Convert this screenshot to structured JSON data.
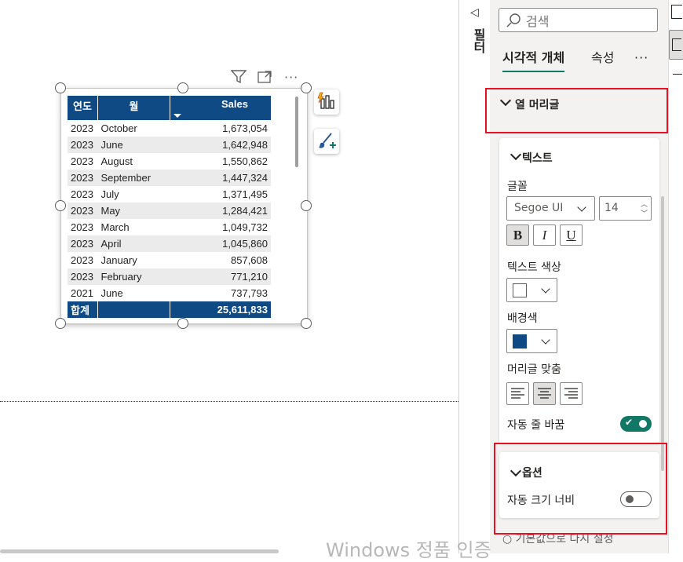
{
  "visual_header": {
    "filter_icon": "funnel-icon",
    "focus_icon": "focus-mode-icon",
    "more_label": "···"
  },
  "table": {
    "headers": [
      "연도",
      "월",
      "Sales"
    ],
    "rows": [
      [
        "2023",
        "October",
        "1,673,054"
      ],
      [
        "2023",
        "June",
        "1,642,948"
      ],
      [
        "2023",
        "August",
        "1,550,862"
      ],
      [
        "2023",
        "September",
        "1,447,324"
      ],
      [
        "2023",
        "July",
        "1,371,495"
      ],
      [
        "2023",
        "May",
        "1,284,421"
      ],
      [
        "2023",
        "March",
        "1,049,732"
      ],
      [
        "2023",
        "April",
        "1,045,860"
      ],
      [
        "2023",
        "January",
        "857,608"
      ],
      [
        "2023",
        "February",
        "771,210"
      ],
      [
        "2021",
        "June",
        "737,793"
      ]
    ],
    "total_label": "합계",
    "total_value": "25,611,833",
    "header_bg": "#0f4a85"
  },
  "float_buttons": {
    "build_icon": "build-visual-icon",
    "format_icon": "format-brush-icon"
  },
  "filter_rail": {
    "label": "필터"
  },
  "pane": {
    "search_placeholder": "검색",
    "tabs": {
      "visual": "시각적 개체",
      "general": "속성",
      "more": "···"
    },
    "section_title": "열 머리글",
    "text_group": {
      "title": "텍스트",
      "font_label": "글꼴",
      "font_family": "Segoe UI",
      "font_size": "14",
      "bold": "B",
      "italic": "I",
      "underline": "U",
      "text_color_label": "텍스트 색상",
      "text_color": "#ffffff",
      "bg_color_label": "배경색",
      "bg_color": "#0f4a85",
      "align_label": "머리글 맞춤",
      "wrap_label": "자동 줄 바꿈",
      "wrap_on": true
    },
    "options_group": {
      "title": "옵션",
      "autosize_label": "자동 크기 너비",
      "autosize_on": false
    },
    "reset_label": "기본값으로 다시 설정"
  },
  "watermark": "Windows 정품 인증",
  "colors": {
    "accent": "#117865",
    "highlight": "#e81123"
  }
}
